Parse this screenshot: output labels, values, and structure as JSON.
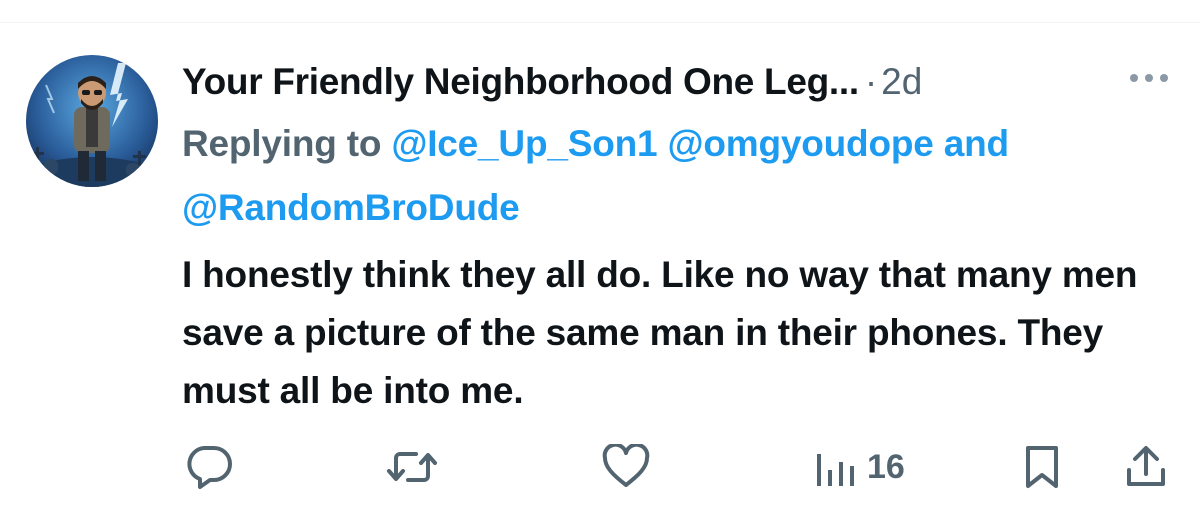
{
  "tweet": {
    "author_name": "Your Friendly Neighborhood One Leg...",
    "separator": "·",
    "time_ago": "2d",
    "replying_to_label": "Replying to",
    "mentions": [
      "@Ice_Up_Son1",
      "@omgyoudope",
      "@RandomBroDude"
    ],
    "mentions_joiner": "and",
    "text": "I honestly think they all do. Like no way that many men save a picture of the same man in their phones. They must all be into me."
  },
  "actions": {
    "reply_icon": "reply-bubble-icon",
    "retweet_icon": "retweet-icon",
    "like_icon": "heart-icon",
    "views_icon": "analytics-bars-icon",
    "views_count": "16",
    "bookmark_icon": "bookmark-icon",
    "share_icon": "share-upload-icon"
  },
  "colors": {
    "text_primary": "#0f1419",
    "text_secondary": "#536471",
    "accent": "#1d9bf0"
  }
}
